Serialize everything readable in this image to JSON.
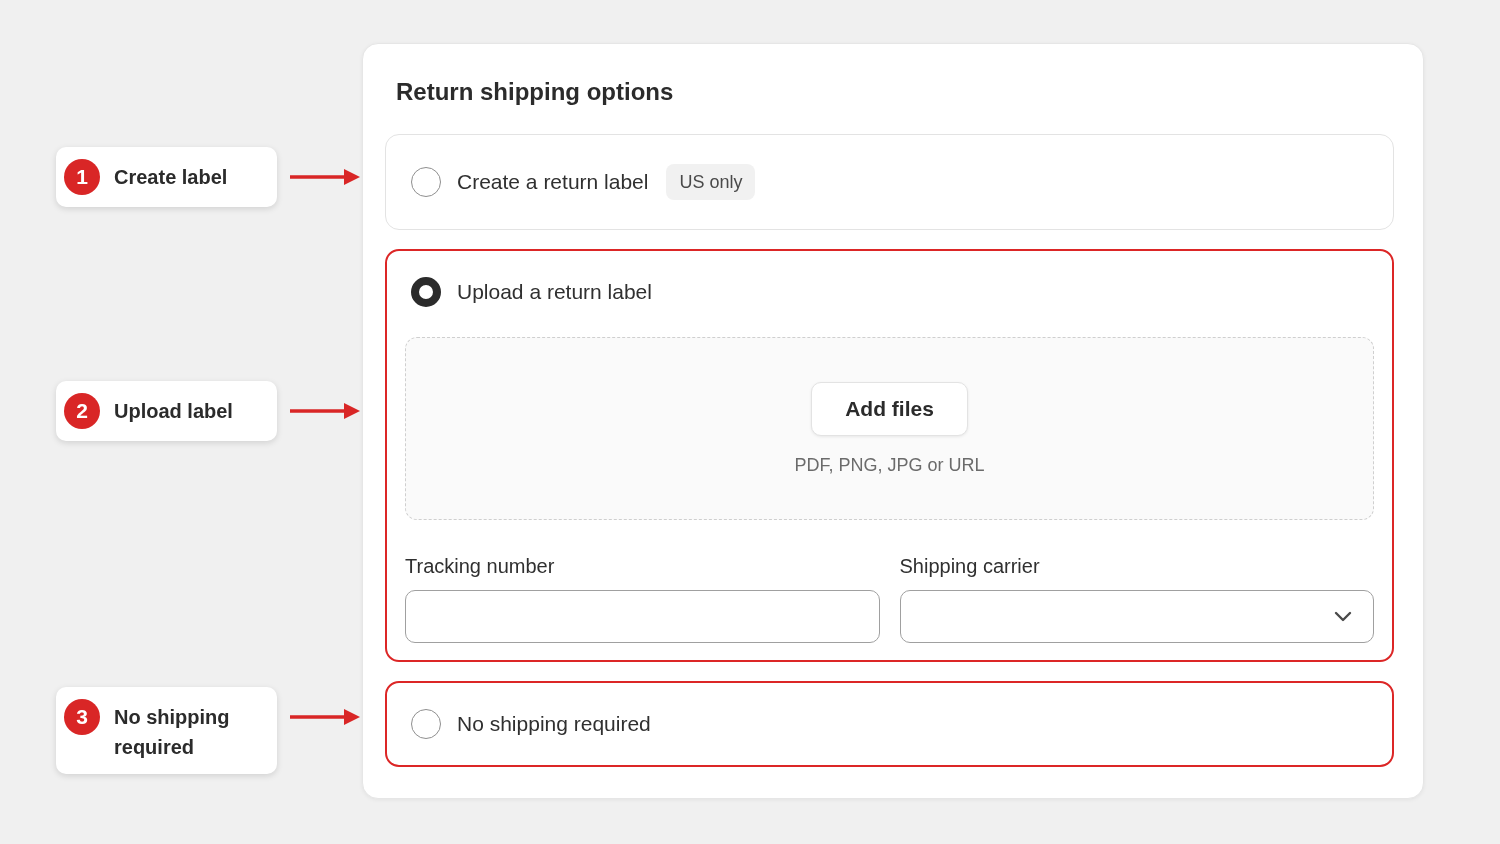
{
  "annotations": [
    {
      "number": "1",
      "label": "Create label"
    },
    {
      "number": "2",
      "label": "Upload label"
    },
    {
      "number": "3",
      "label": "No shipping required"
    }
  ],
  "panel": {
    "title": "Return shipping options",
    "options": [
      {
        "kind": "simple",
        "label": "Create a return label",
        "badge": "US only",
        "selected": false,
        "highlighted": false
      },
      {
        "kind": "upload",
        "label": "Upload a return label",
        "selected": true,
        "highlighted": true,
        "upload": {
          "button": "Add files",
          "hint": "PDF, PNG, JPG or URL"
        },
        "fields": [
          {
            "kind": "text",
            "label": "Tracking number"
          },
          {
            "kind": "select",
            "label": "Shipping carrier"
          }
        ]
      },
      {
        "kind": "simple",
        "label": "No shipping required",
        "selected": false,
        "highlighted": true
      }
    ]
  }
}
